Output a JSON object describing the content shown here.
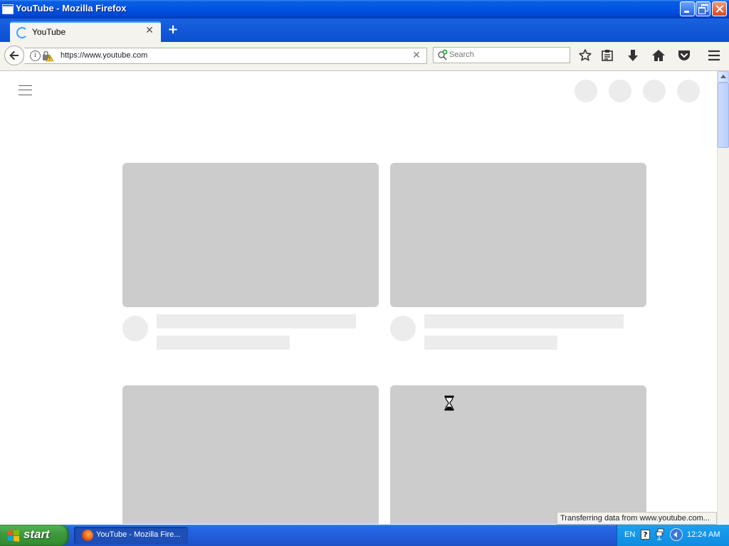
{
  "window": {
    "title": "YouTube - Mozilla Firefox"
  },
  "tab": {
    "label": "YouTube"
  },
  "navbar": {
    "url": "https://www.youtube.com",
    "search_placeholder": "Search"
  },
  "status": {
    "text": "Transferring data from www.youtube.com..."
  },
  "taskbar": {
    "start_label": "start",
    "task_label": "YouTube - Mozilla Fire...",
    "lang": "EN",
    "help": "?",
    "clock": "12:24 AM"
  },
  "colors": {
    "skeleton_thumb": "#cccccc",
    "skeleton_light": "#ececec",
    "xp_blue": "#0054e3",
    "start_green": "#3f9a3c"
  },
  "icons": {
    "back": "back-arrow-icon",
    "info": "info-icon",
    "lock": "insecure-lock-icon",
    "bookmark": "star-icon",
    "reading_list": "clipboard-icon",
    "downloads": "download-arrow-icon",
    "home": "home-icon",
    "pocket": "pocket-icon",
    "menu": "hamburger-icon"
  }
}
